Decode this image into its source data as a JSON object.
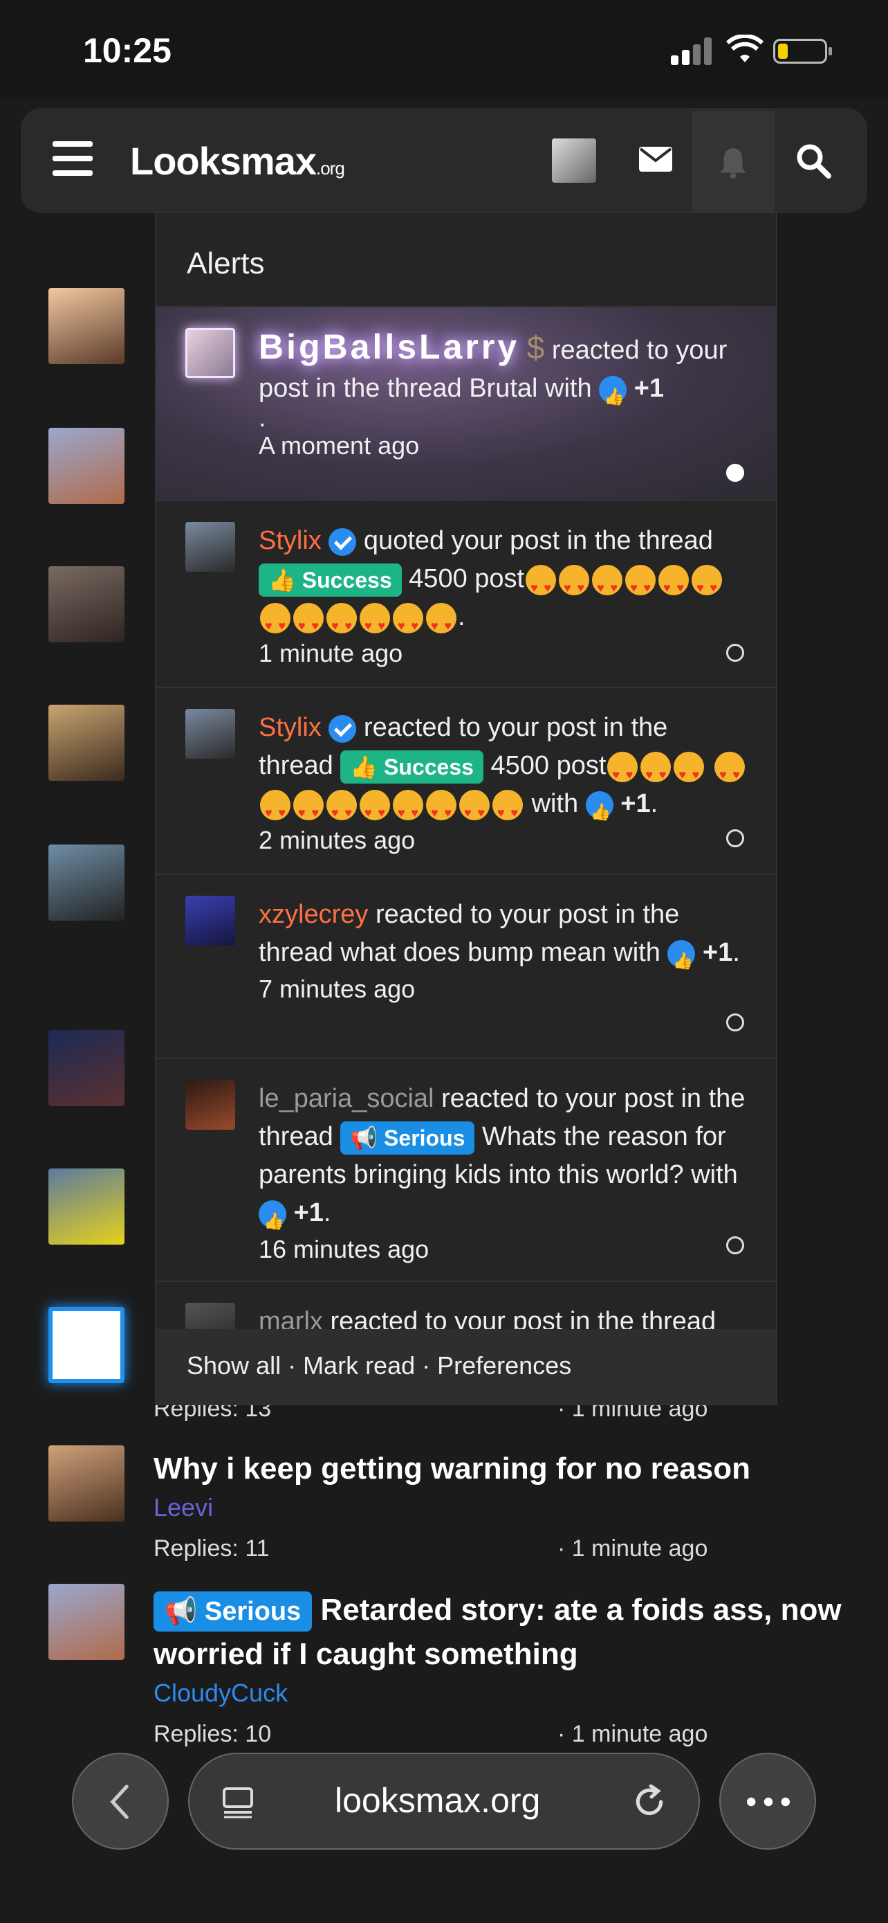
{
  "status": {
    "time": "10:25"
  },
  "nav": {
    "logo_main": "Looksmax",
    "logo_tld": ".org"
  },
  "alerts": {
    "title": "Alerts",
    "items": [
      {
        "user": "BigBallsLarry",
        "text": "reacted to your post in the thread Brutal with",
        "reaction": "+1",
        "trail": ".",
        "time": "A moment ago",
        "unread": true
      },
      {
        "user": "Stylix",
        "text": "quoted your post in the thread",
        "prefix": "Success",
        "thread": "4500 post",
        "trail": ".",
        "time": "1 minute ago"
      },
      {
        "user": "Stylix",
        "text": "reacted to your post in the thread",
        "prefix": "Success",
        "thread": "4500 post",
        "with": "with",
        "reaction": "+1",
        "trail": ".",
        "time": "2 minutes ago"
      },
      {
        "user": "xzylecrey",
        "text": "reacted to your post in the thread what does bump mean with",
        "reaction": "+1",
        "trail": ".",
        "time": "7 minutes ago"
      },
      {
        "user": "le_paria_social",
        "text": "reacted to your post in the thread",
        "prefix": "Serious",
        "thread": "Whats the reason for parents bringing kids into this world?",
        "with": "with",
        "reaction": "+1",
        "trail": ".",
        "time": "16 minutes ago"
      },
      {
        "user": "marlx",
        "text": "reacted to your post in the thread"
      }
    ],
    "footer": "Show all · Mark read · Preferences"
  },
  "threads": [
    {
      "replies": "Replies: 13",
      "time": "· 1 minute ago"
    },
    {
      "title": "Why i keep getting warning for no reason",
      "author": "Leevi",
      "author_color": "#6b63d6",
      "replies": "Replies: 11",
      "time": "· 1 minute ago"
    },
    {
      "prefix": "Serious",
      "title": "Retarded story: ate a foids ass, now worried if I caught something",
      "author": "CloudyCuck",
      "author_color": "#2b8cf0",
      "replies": "Replies: 10",
      "time": "· 1 minute ago"
    }
  ],
  "browser": {
    "url": "looksmax.org"
  },
  "colors": {
    "accent_orange": "#ff7043",
    "success": "#1db486",
    "serious": "#1a8ee5"
  }
}
